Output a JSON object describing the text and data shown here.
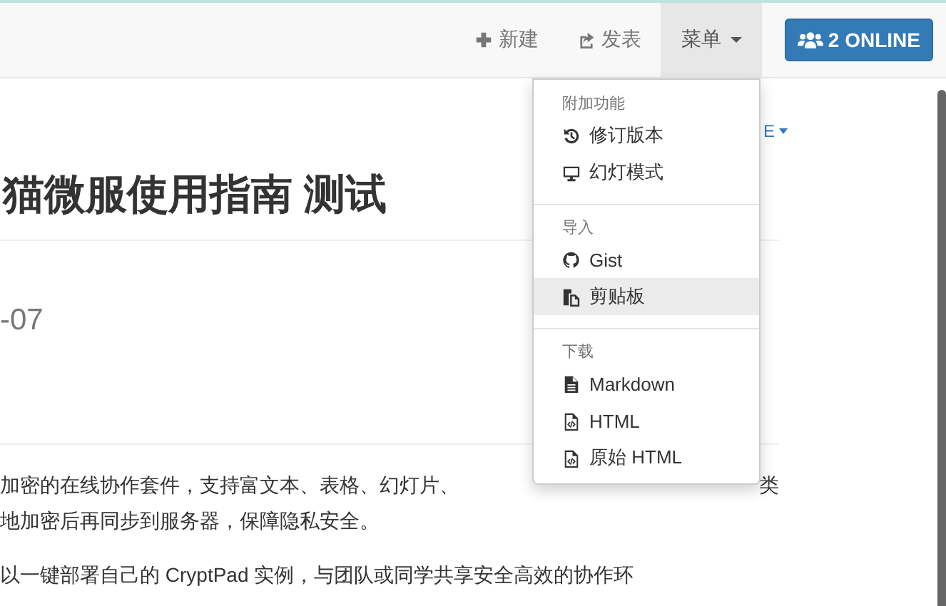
{
  "navbar": {
    "items": [
      {
        "kind": "new",
        "label": "新建",
        "active": false
      },
      {
        "kind": "publish",
        "label": "发表",
        "active": false
      },
      {
        "kind": "menu",
        "label": "菜单",
        "active": true
      }
    ],
    "online_button": {
      "label": "2 ONLINE"
    }
  },
  "document": {
    "title": "猫微服使用指南 测试",
    "side_link": "E",
    "date": "-07",
    "lines": [
      {
        "left": "加密的在线协作套件，支持富文本、表格、幻灯片、",
        "right": "类"
      },
      {
        "left": "地加密后再同步到服务器，保障隐私安全。"
      }
    ],
    "paragraph_2": "以一键部署自己的 CryptPad 实例，与团队或同学共享安全高效的协作环"
  },
  "dropdown": {
    "sections": [
      {
        "header": "附加功能",
        "items": [
          {
            "kind": "history",
            "label": "修订版本",
            "highlighted": false
          },
          {
            "kind": "desktop",
            "label": "幻灯模式",
            "highlighted": false
          }
        ]
      },
      {
        "header": "导入",
        "items": [
          {
            "kind": "github",
            "label": "Gist",
            "highlighted": false
          },
          {
            "kind": "paste",
            "label": "剪贴板",
            "highlighted": true
          }
        ]
      },
      {
        "header": "下载",
        "items": [
          {
            "kind": "file-text",
            "label": "Markdown",
            "highlighted": false
          },
          {
            "kind": "file-code",
            "label": "HTML",
            "highlighted": false
          },
          {
            "kind": "file-code",
            "label": "原始 HTML",
            "highlighted": false
          }
        ]
      }
    ]
  }
}
